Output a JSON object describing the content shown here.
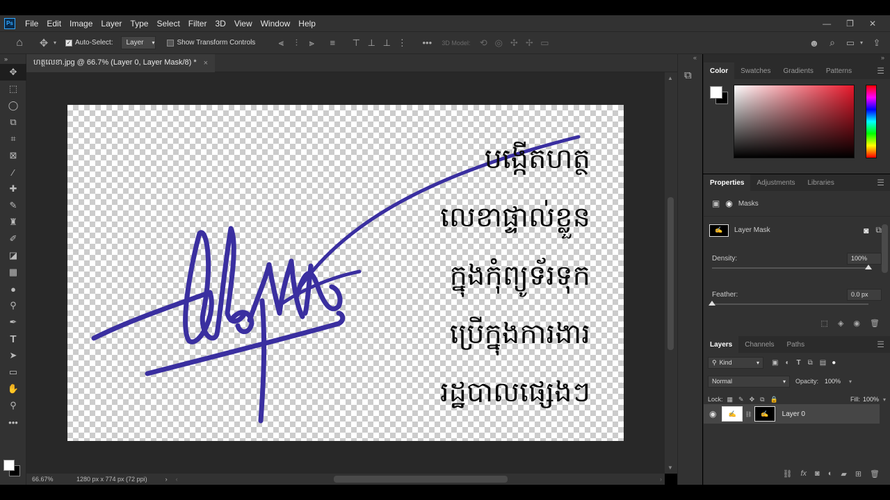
{
  "menubar": {
    "logo": "Ps",
    "items": [
      "File",
      "Edit",
      "Image",
      "Layer",
      "Type",
      "Select",
      "Filter",
      "3D",
      "View",
      "Window",
      "Help"
    ],
    "window_controls": [
      "—",
      "❐",
      "✕"
    ]
  },
  "options": {
    "auto_select_label": "Auto-Select:",
    "auto_select_checked": true,
    "auto_select_target": "Layer",
    "show_transform_label": "Show Transform Controls",
    "show_transform_checked": false,
    "mode_3d_label": "3D Model:"
  },
  "document": {
    "tab_title": "ហត្ថលេខា.jpg @ 66.7% (Layer 0, Layer Mask/8) *",
    "zoom": "66.67%",
    "dimensions": "1280 px x 774 px (72 ppi)",
    "khmer_lines": [
      "បង្កើតហត្ថ",
      "លេខាផ្ទាល់ខ្លួន",
      "ក្នុងកុំព្យូទ័រទុក",
      "ប្រើក្នុងការងារ",
      "រដ្ឋបាលផ្សេងៗ"
    ],
    "signature_color": "#3a2fa0"
  },
  "color_panel": {
    "tabs": [
      "Color",
      "Swatches",
      "Gradients",
      "Patterns"
    ],
    "active": "Color"
  },
  "properties_panel": {
    "tabs": [
      "Properties",
      "Adjustments",
      "Libraries"
    ],
    "active": "Properties",
    "section": "Masks",
    "mask_label": "Layer Mask",
    "density_label": "Density:",
    "density_value": "100%",
    "density_fraction": 1.0,
    "feather_label": "Feather:",
    "feather_value": "0.0 px",
    "feather_fraction": 0.0
  },
  "layers_panel": {
    "tabs": [
      "Layers",
      "Channels",
      "Paths"
    ],
    "active": "Layers",
    "filter_kind": "Kind",
    "blend_mode": "Normal",
    "opacity_label": "Opacity:",
    "opacity_value": "100%",
    "lock_label": "Lock:",
    "fill_label": "Fill:",
    "fill_value": "100%",
    "layers": [
      {
        "name": "Layer 0",
        "visible": true
      }
    ]
  },
  "colors": {
    "app_bg": "#323232",
    "canvas_area": "#282828",
    "accent": "#31a8ff"
  }
}
